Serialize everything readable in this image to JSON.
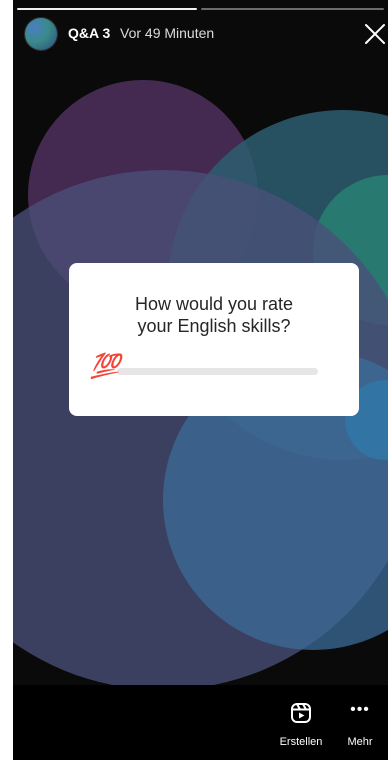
{
  "story": {
    "user_name": "Q&A 3",
    "time_ago": "Vor 49 Minuten",
    "progress_segments": 2,
    "active_segment": 1
  },
  "card": {
    "question": "How would you rate\nyour English skills?",
    "slider_emoji": "💯",
    "slider_emoji_name": "hundred-points-icon",
    "slider_value": 0
  },
  "footer": {
    "create_label": "Erstellen",
    "more_label": "Mehr",
    "create_icon": "reels-icon",
    "more_icon": "more-dots-icon"
  },
  "colors": {
    "card_bg": "#ffffff",
    "slider_track": "#e6e6e6",
    "emoji_red": "#d8232a",
    "story_bg": "#000000"
  }
}
